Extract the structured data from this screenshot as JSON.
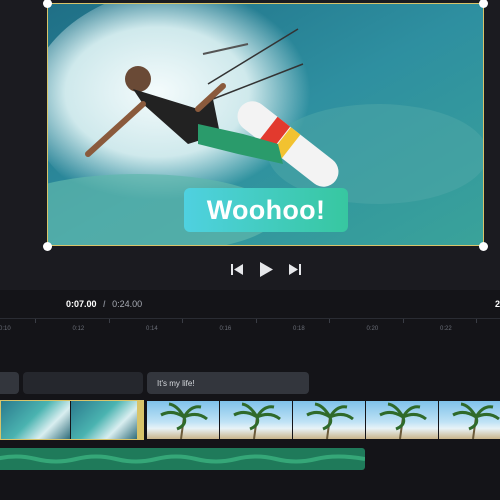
{
  "caption": {
    "text": "Woohoo!"
  },
  "playback": {
    "skip_back_icon": "skip-back-icon",
    "play_icon": "play-icon",
    "skip_forward_icon": "skip-forward-icon"
  },
  "timeline": {
    "current_time": "0:07.00",
    "separator": "/",
    "total_time": "0:24.00",
    "edge_marker": "2",
    "ticks": [
      "0:10",
      "0:12",
      "0:14",
      "0:16",
      "0:18",
      "0:20",
      "0:22"
    ],
    "text_clips": [
      {
        "label": ""
      },
      {
        "label": ""
      },
      {
        "label": "It's my life!"
      }
    ],
    "video_track": {
      "clips": [
        "kitesurf",
        "palm-beach"
      ]
    }
  },
  "colors": {
    "accent": "#d8c46a",
    "caption_gradient_start": "#4fd1e0",
    "caption_gradient_end": "#37c7a0",
    "audio_track": "#1f7a5a",
    "text_clip": "#33363d"
  }
}
